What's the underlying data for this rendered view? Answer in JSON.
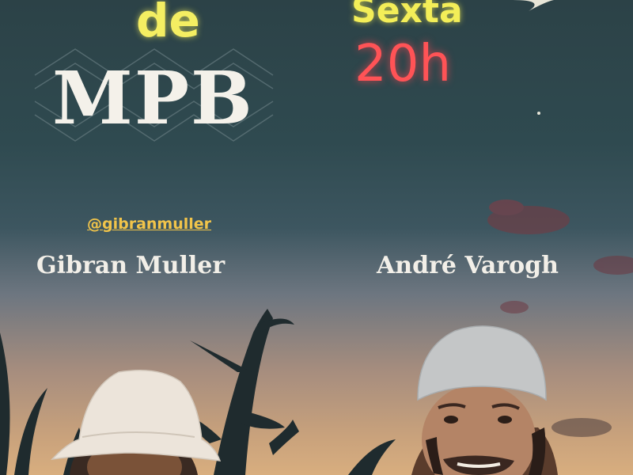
{
  "title": {
    "de": "de",
    "genre": "MPB"
  },
  "schedule": {
    "day": "Sexta",
    "time": "20h"
  },
  "artists": {
    "handle": "@gibranmuller",
    "left_name": "Gibran Muller",
    "right_name": "André Varogh"
  },
  "colors": {
    "neon_yellow": "#f4ee62",
    "neon_red": "#ff5356",
    "handle_gold": "#f1c44a",
    "sky_top": "#2c4247",
    "sky_bottom": "#d8ae7f"
  }
}
